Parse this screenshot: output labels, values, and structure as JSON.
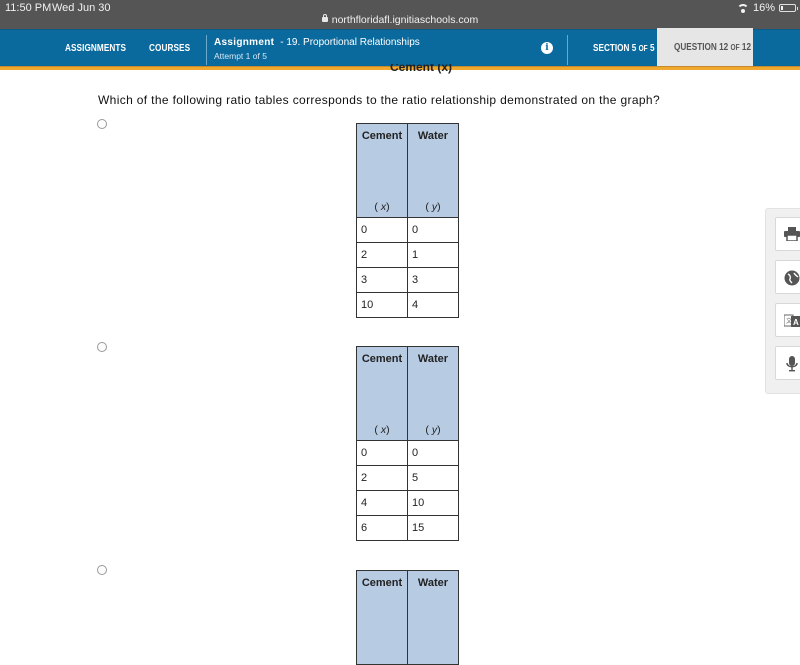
{
  "status_bar": {
    "time": "11:50 PM",
    "date": "Wed Jun 30",
    "url": "northfloridafl.ignitiaschools.com",
    "battery": "16%"
  },
  "nav": {
    "assignments": "ASSIGNMENTS",
    "courses": "COURSES",
    "assignment_label": "Assignment",
    "assignment_title": "- 19. Proportional Relationships",
    "attempt": "Attempt 1 of 5",
    "section_word": "SECTION 5",
    "section_of": "OF",
    "section_total": "5",
    "question_word": "QUESTION 12",
    "question_of": "OF",
    "question_total": "12"
  },
  "graph_axis_label_cut": "Cement (x)",
  "question": "Which of the following ratio tables corresponds to the ratio relationship demonstrated on the graph?",
  "options": [
    {
      "headers": [
        "Cement",
        "Water"
      ],
      "vars": [
        "x",
        "y"
      ],
      "rows": [
        [
          "0",
          "0"
        ],
        [
          "2",
          "1"
        ],
        [
          "3",
          "3"
        ],
        [
          "10",
          "4"
        ]
      ]
    },
    {
      "headers": [
        "Cement",
        "Water"
      ],
      "vars": [
        "x",
        "y"
      ],
      "rows": [
        [
          "0",
          "0"
        ],
        [
          "2",
          "5"
        ],
        [
          "4",
          "10"
        ],
        [
          "6",
          "15"
        ]
      ]
    },
    {
      "headers": [
        "Cement",
        "Water"
      ]
    }
  ],
  "tools": [
    "printer-icon",
    "globe-icon",
    "translate-icon",
    "microphone-icon"
  ]
}
